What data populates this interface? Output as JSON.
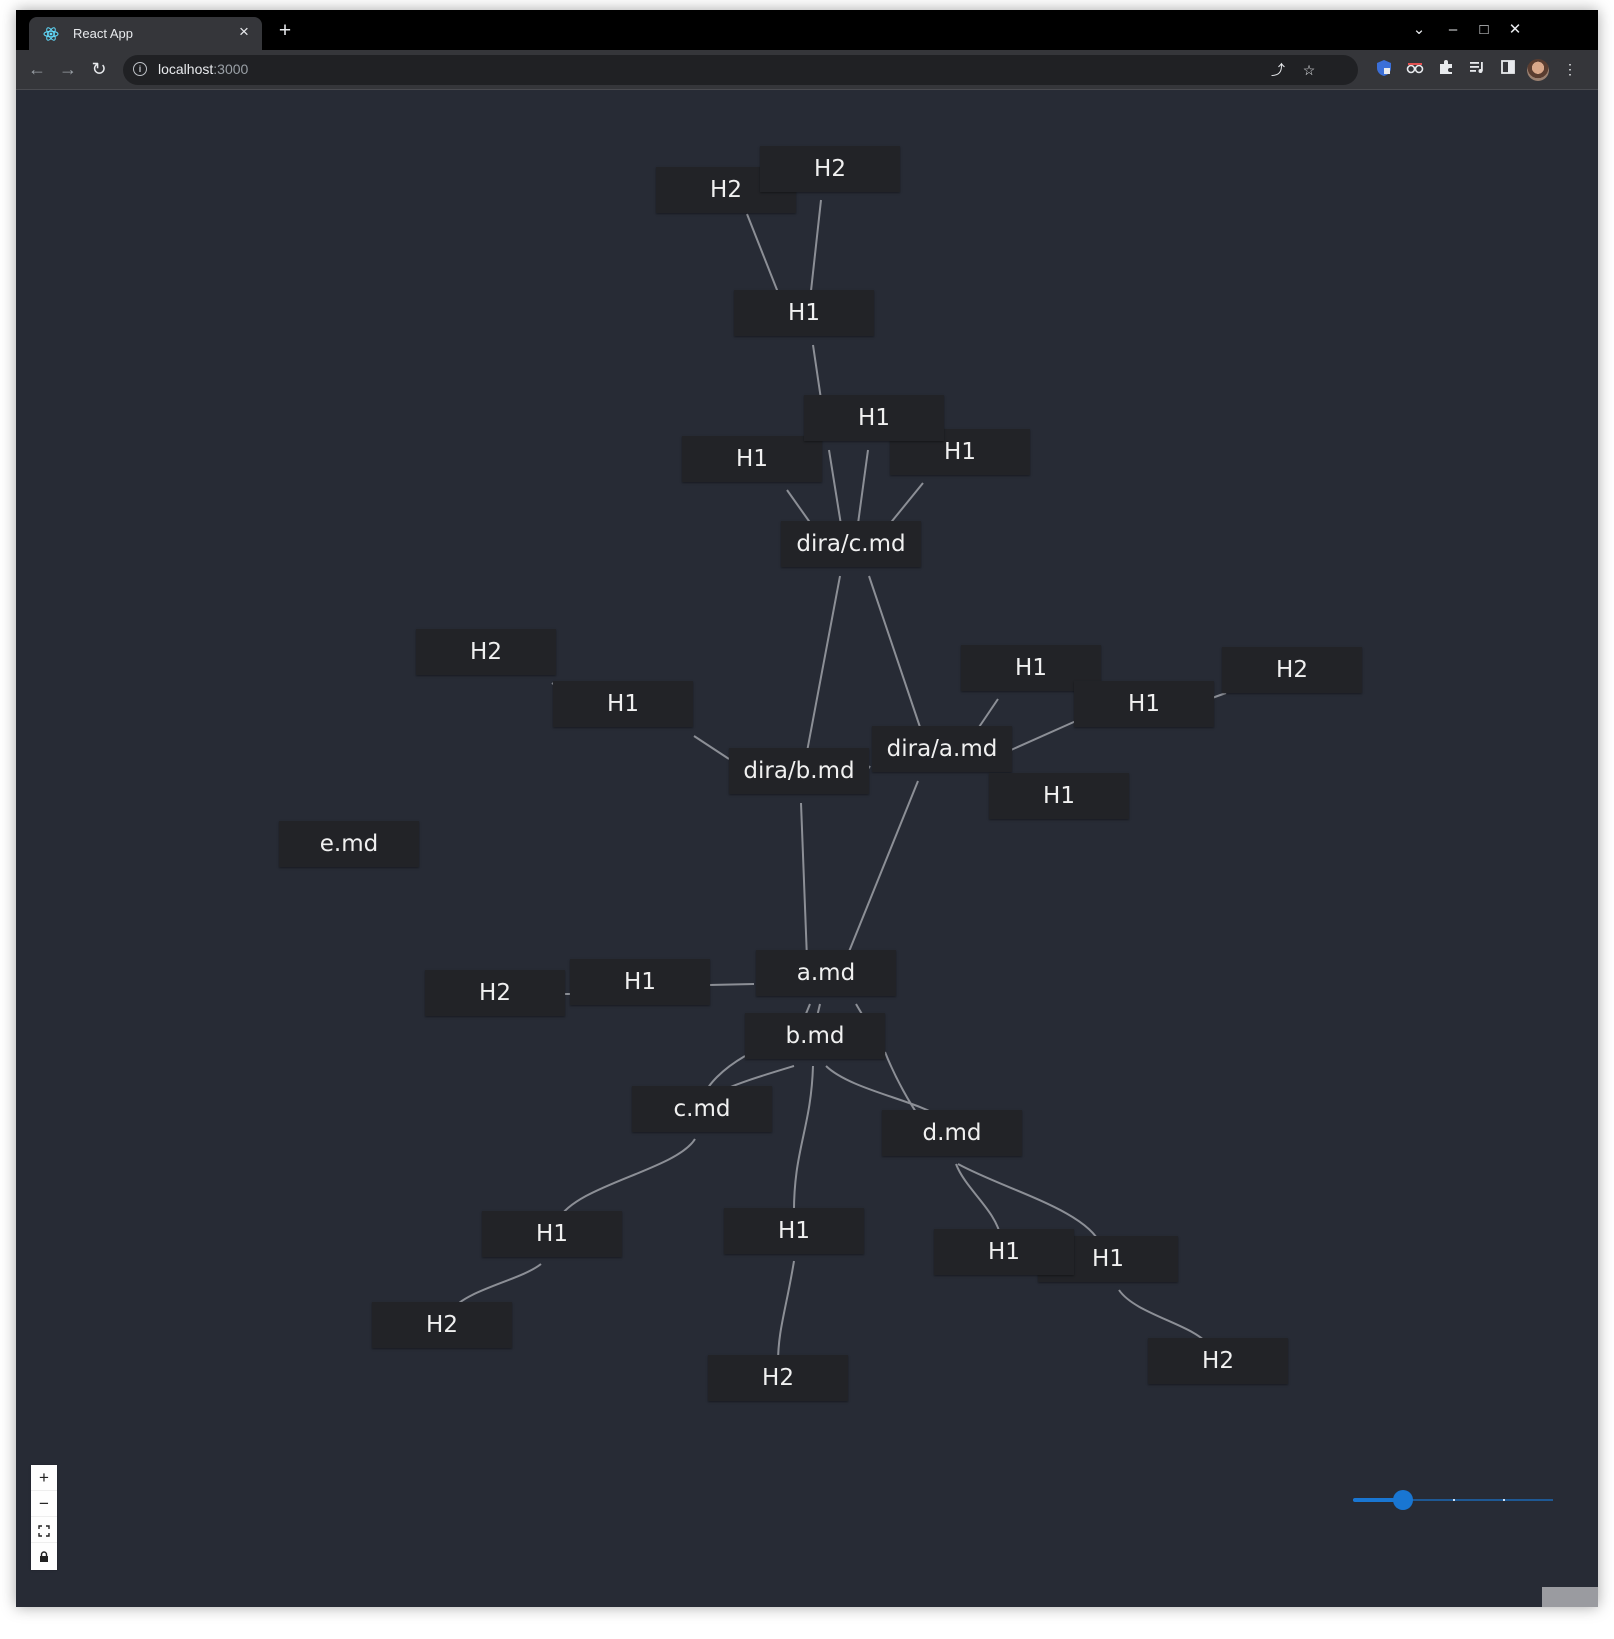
{
  "browser": {
    "tab_title": "React App",
    "tab_close": "×",
    "new_tab": "+",
    "url_host": "localhost",
    "url_port": ":3000",
    "window_controls": {
      "dropdown": "⌄",
      "minimize": "–",
      "maximize": "□",
      "close": "✕"
    },
    "nav": {
      "back": "←",
      "forward": "→",
      "reload": "↻"
    },
    "omnibox_icons": {
      "share": "⤴",
      "bookmark": "☆"
    },
    "extensions": [
      "shield-icon",
      "glasses-icon",
      "puzzle-icon",
      "playlist-icon",
      "sidepanel-icon"
    ],
    "menu": "⋮"
  },
  "graph": {
    "nodes": [
      {
        "id": "n_h2_top_a",
        "label": "H2"
      },
      {
        "id": "n_h2_top_b",
        "label": "H2"
      },
      {
        "id": "n_h1_top",
        "label": "H1"
      },
      {
        "id": "n_h1_c_mid",
        "label": "H1"
      },
      {
        "id": "n_h1_c_left",
        "label": "H1"
      },
      {
        "id": "n_h1_c_right",
        "label": "H1"
      },
      {
        "id": "n_dira_c",
        "label": "dira/c.md"
      },
      {
        "id": "n_h2_left",
        "label": "H2"
      },
      {
        "id": "n_h1_left",
        "label": "H1"
      },
      {
        "id": "n_h1_a_top",
        "label": "H1"
      },
      {
        "id": "n_h2_right",
        "label": "H2"
      },
      {
        "id": "n_h1_a_right",
        "label": "H1"
      },
      {
        "id": "n_dira_a",
        "label": "dira/a.md"
      },
      {
        "id": "n_dira_b",
        "label": "dira/b.md"
      },
      {
        "id": "n_h1_a_bottom",
        "label": "H1"
      },
      {
        "id": "n_e",
        "label": "e.md"
      },
      {
        "id": "n_a",
        "label": "a.md"
      },
      {
        "id": "n_h1_amd",
        "label": "H1"
      },
      {
        "id": "n_h2_amd",
        "label": "H2"
      },
      {
        "id": "n_b",
        "label": "b.md"
      },
      {
        "id": "n_c",
        "label": "c.md"
      },
      {
        "id": "n_d",
        "label": "d.md"
      },
      {
        "id": "n_h1_cmd",
        "label": "H1"
      },
      {
        "id": "n_h2_cmd",
        "label": "H2"
      },
      {
        "id": "n_h1_bmd",
        "label": "H1"
      },
      {
        "id": "n_h2_bmd",
        "label": "H2"
      },
      {
        "id": "n_h1_dmd_a",
        "label": "H1"
      },
      {
        "id": "n_h1_dmd_b",
        "label": "H1"
      },
      {
        "id": "n_h2_dmd",
        "label": "H2"
      }
    ]
  },
  "controls": {
    "zoom_in": "+",
    "zoom_out": "−",
    "fit_view": "⛶",
    "lock": "🔒"
  },
  "zoom_slider": {
    "value": 0.25
  },
  "colors": {
    "canvas": "#272b35",
    "node": "#222327",
    "edge": "#8c8f96",
    "accent": "#1976d2"
  }
}
